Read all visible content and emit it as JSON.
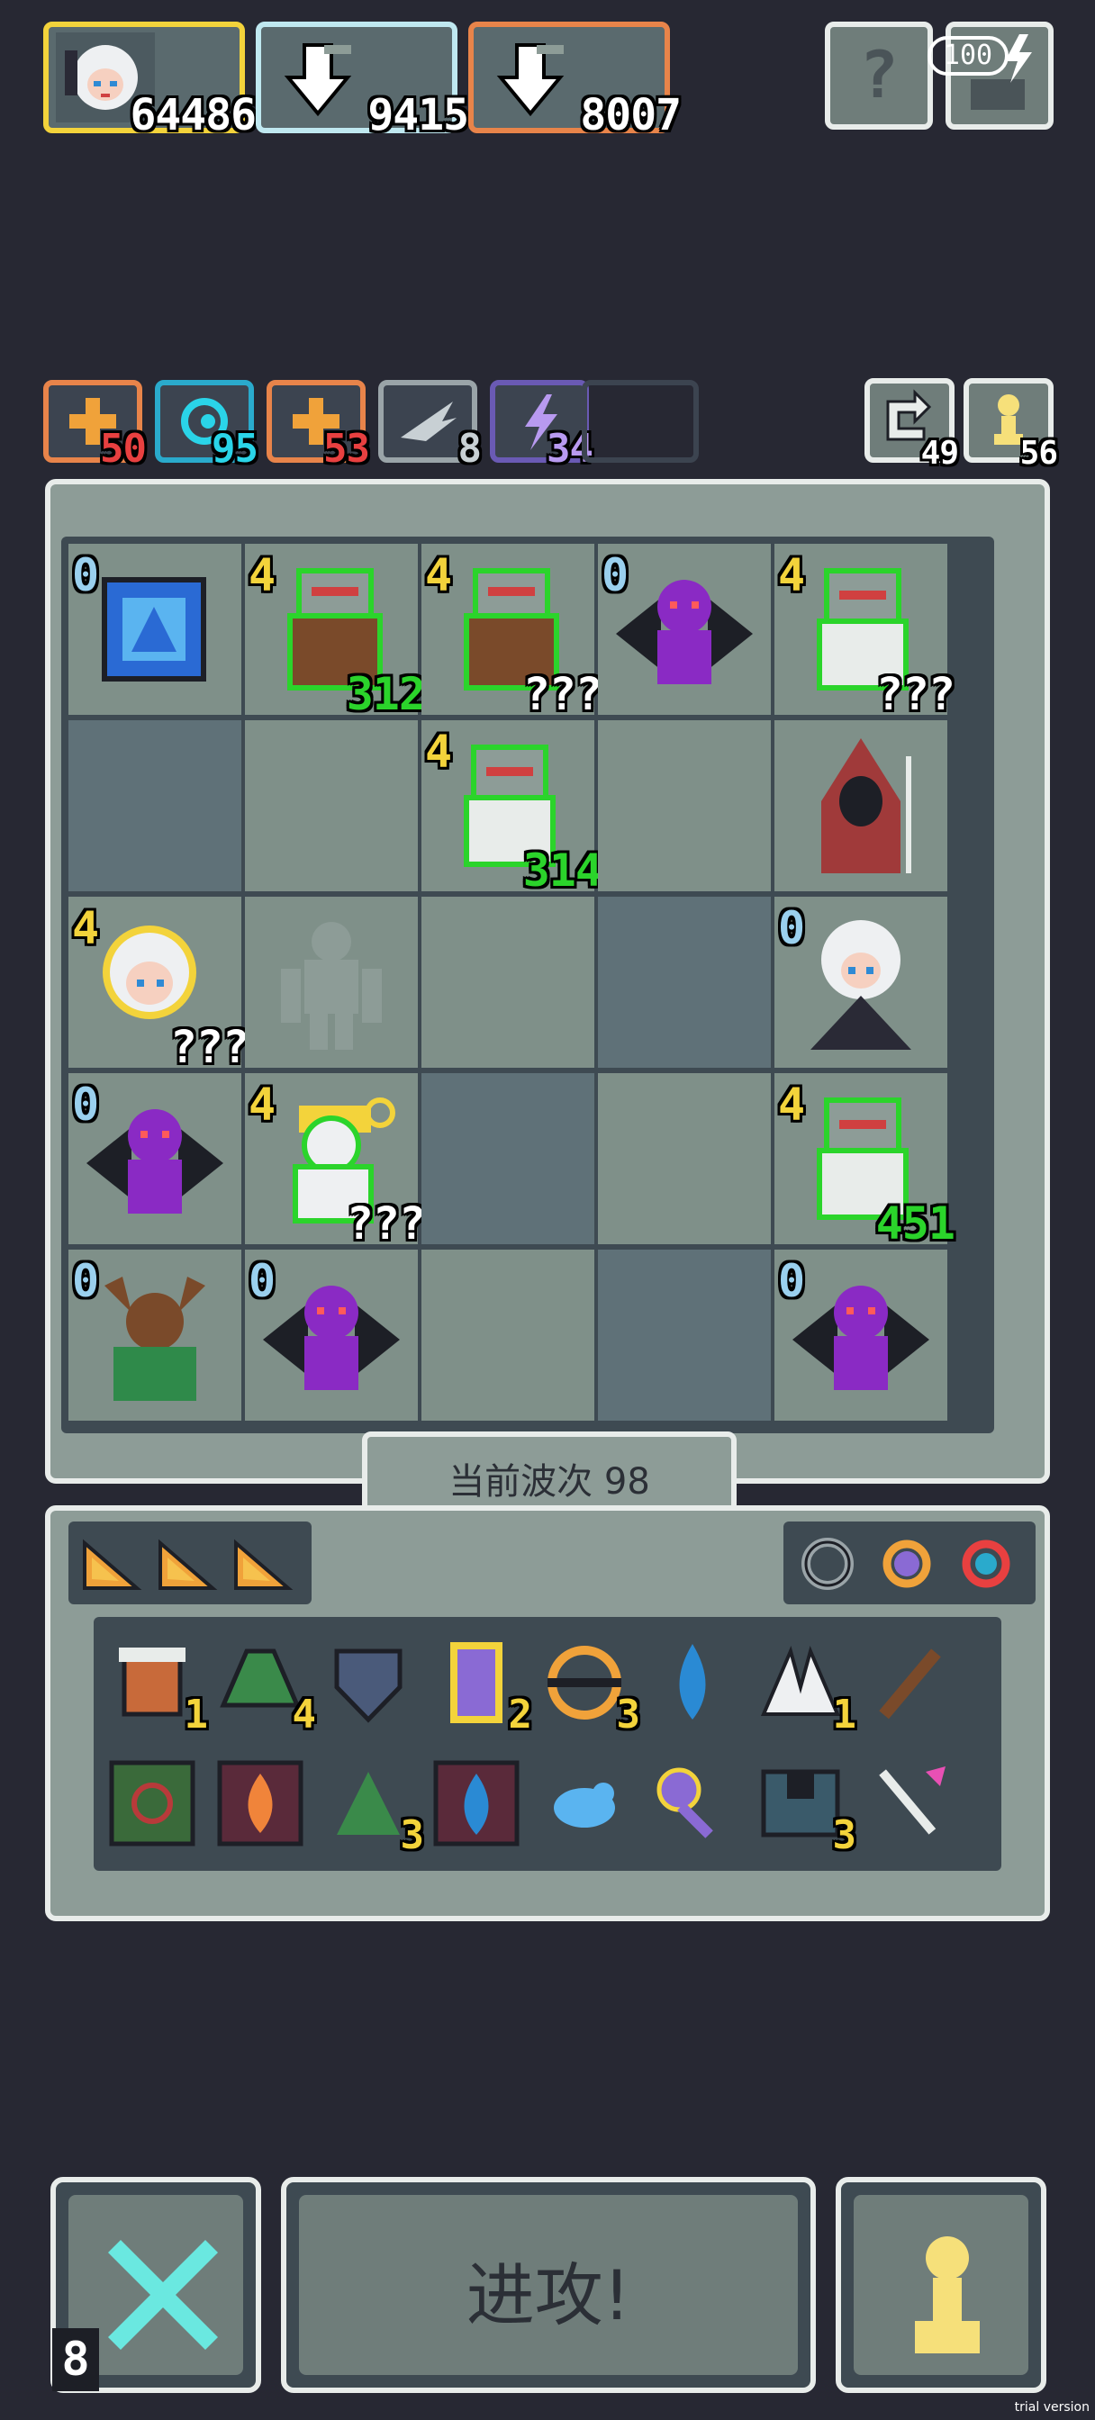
{
  "heroes": [
    {
      "name": "hero-mage",
      "score": "64486",
      "border": "#f3d33b"
    },
    {
      "name": "hero-slot-2",
      "score": "9415",
      "border": "#bfe8f0"
    },
    {
      "name": "hero-slot-3",
      "score": "8007",
      "border": "#e8844a"
    }
  ],
  "top_buttons": {
    "help": "?",
    "energy": "100"
  },
  "elements": [
    {
      "icon": "plus-fire-icon",
      "count": "50",
      "color": "#e8844a",
      "count_color": "#e84040"
    },
    {
      "icon": "swirl-water-icon",
      "count": "95",
      "color": "#2aaacc",
      "count_color": "#2ad4e8"
    },
    {
      "icon": "plus-fire-icon",
      "count": "53",
      "color": "#e8844a",
      "count_color": "#e84040"
    },
    {
      "icon": "wing-icon",
      "count": "8",
      "color": "#9aa4a8",
      "count_color": "#c8d0d4"
    },
    {
      "icon": "lightning-icon",
      "count": "34",
      "color": "#6a5ab4",
      "count_color": "#b89af0"
    }
  ],
  "counters": {
    "refresh": "49",
    "pawn": "56"
  },
  "board": [
    [
      {
        "level": "0",
        "unit": "blue-crate",
        "num": ""
      },
      {
        "level": "4",
        "unit": "shield-knight",
        "num": "312"
      },
      {
        "level": "4",
        "unit": "shield-knight",
        "num": "???"
      },
      {
        "level": "0",
        "unit": "purple-dragon",
        "num": ""
      },
      {
        "level": "4",
        "unit": "armored-knight",
        "num": "???"
      }
    ],
    [
      {
        "level": "",
        "unit": "",
        "num": ""
      },
      {
        "level": "",
        "unit": "",
        "num": ""
      },
      {
        "level": "4",
        "unit": "armored-knight",
        "num": "314"
      },
      {
        "level": "",
        "unit": "",
        "num": ""
      },
      {
        "level": "",
        "unit": "red-hooded-mage",
        "num": ""
      }
    ],
    [
      {
        "level": "4",
        "unit": "white-hair-girl",
        "num": "???"
      },
      {
        "level": "",
        "unit": "stone-golem",
        "num": ""
      },
      {
        "level": "",
        "unit": "",
        "num": ""
      },
      {
        "level": "",
        "unit": "",
        "num": ""
      },
      {
        "level": "0",
        "unit": "white-hair-witch",
        "num": ""
      }
    ],
    [
      {
        "level": "0",
        "unit": "purple-dragon",
        "num": ""
      },
      {
        "level": "4",
        "unit": "white-priest",
        "num": "???"
      },
      {
        "level": "",
        "unit": "",
        "num": ""
      },
      {
        "level": "",
        "unit": "",
        "num": ""
      },
      {
        "level": "4",
        "unit": "armored-knight",
        "num": "451"
      }
    ],
    [
      {
        "level": "0",
        "unit": "horned-beast",
        "num": ""
      },
      {
        "level": "0",
        "unit": "purple-dragon",
        "num": ""
      },
      {
        "level": "",
        "unit": "",
        "num": ""
      },
      {
        "level": "",
        "unit": "",
        "num": ""
      },
      {
        "level": "0",
        "unit": "purple-dragon",
        "num": ""
      }
    ]
  ],
  "wave": {
    "label": "当前波次 98"
  },
  "inventory": {
    "row1": [
      {
        "icon": "bucket-icon",
        "count": "1",
        "yellow": true
      },
      {
        "icon": "green-hat-icon",
        "count": "4",
        "yellow": true
      },
      {
        "icon": "shield-icon",
        "count": "",
        "yellow": false
      },
      {
        "icon": "potion-icon",
        "count": "2",
        "yellow": true
      },
      {
        "icon": "ring-icon",
        "count": "3",
        "yellow": true
      },
      {
        "icon": "water-drop-icon",
        "count": "",
        "yellow": false
      },
      {
        "icon": "wings-icon",
        "count": "1",
        "yellow": true
      },
      {
        "icon": "stick-icon",
        "count": "",
        "yellow": false
      }
    ],
    "row2": [
      {
        "icon": "green-tile-icon",
        "count": "",
        "yellow": false
      },
      {
        "icon": "fire-tile-icon",
        "count": "",
        "yellow": false
      },
      {
        "icon": "herb-icon",
        "count": "3",
        "yellow": true
      },
      {
        "icon": "water-tile-icon",
        "count": "",
        "yellow": false
      },
      {
        "icon": "blue-bird-icon",
        "count": "",
        "yellow": false
      },
      {
        "icon": "purple-key-icon",
        "count": "",
        "yellow": false
      },
      {
        "icon": "chest-armor-icon",
        "count": "3",
        "yellow": true
      },
      {
        "icon": "arrow-icon",
        "count": "",
        "yellow": false
      }
    ]
  },
  "bottom": {
    "cancel_count": "8",
    "attack_label": "进攻!"
  },
  "watermark": "trial version"
}
